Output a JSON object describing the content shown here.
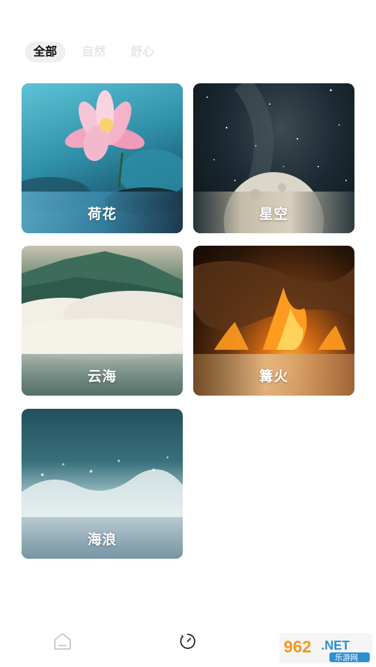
{
  "tabs": [
    {
      "label": "全部",
      "active": true
    },
    {
      "label": "自然",
      "active": false
    },
    {
      "label": "舒心",
      "active": false
    }
  ],
  "cards": [
    {
      "title": "荷花"
    },
    {
      "title": "星空"
    },
    {
      "title": "云海"
    },
    {
      "title": "篝火"
    },
    {
      "title": "海浪"
    }
  ],
  "bottom_nav": [
    {
      "icon": "home-icon"
    },
    {
      "icon": "sleep-timer-icon"
    }
  ],
  "watermark": {
    "number": "962",
    "suffix": ".NET",
    "site": "乐游网"
  }
}
